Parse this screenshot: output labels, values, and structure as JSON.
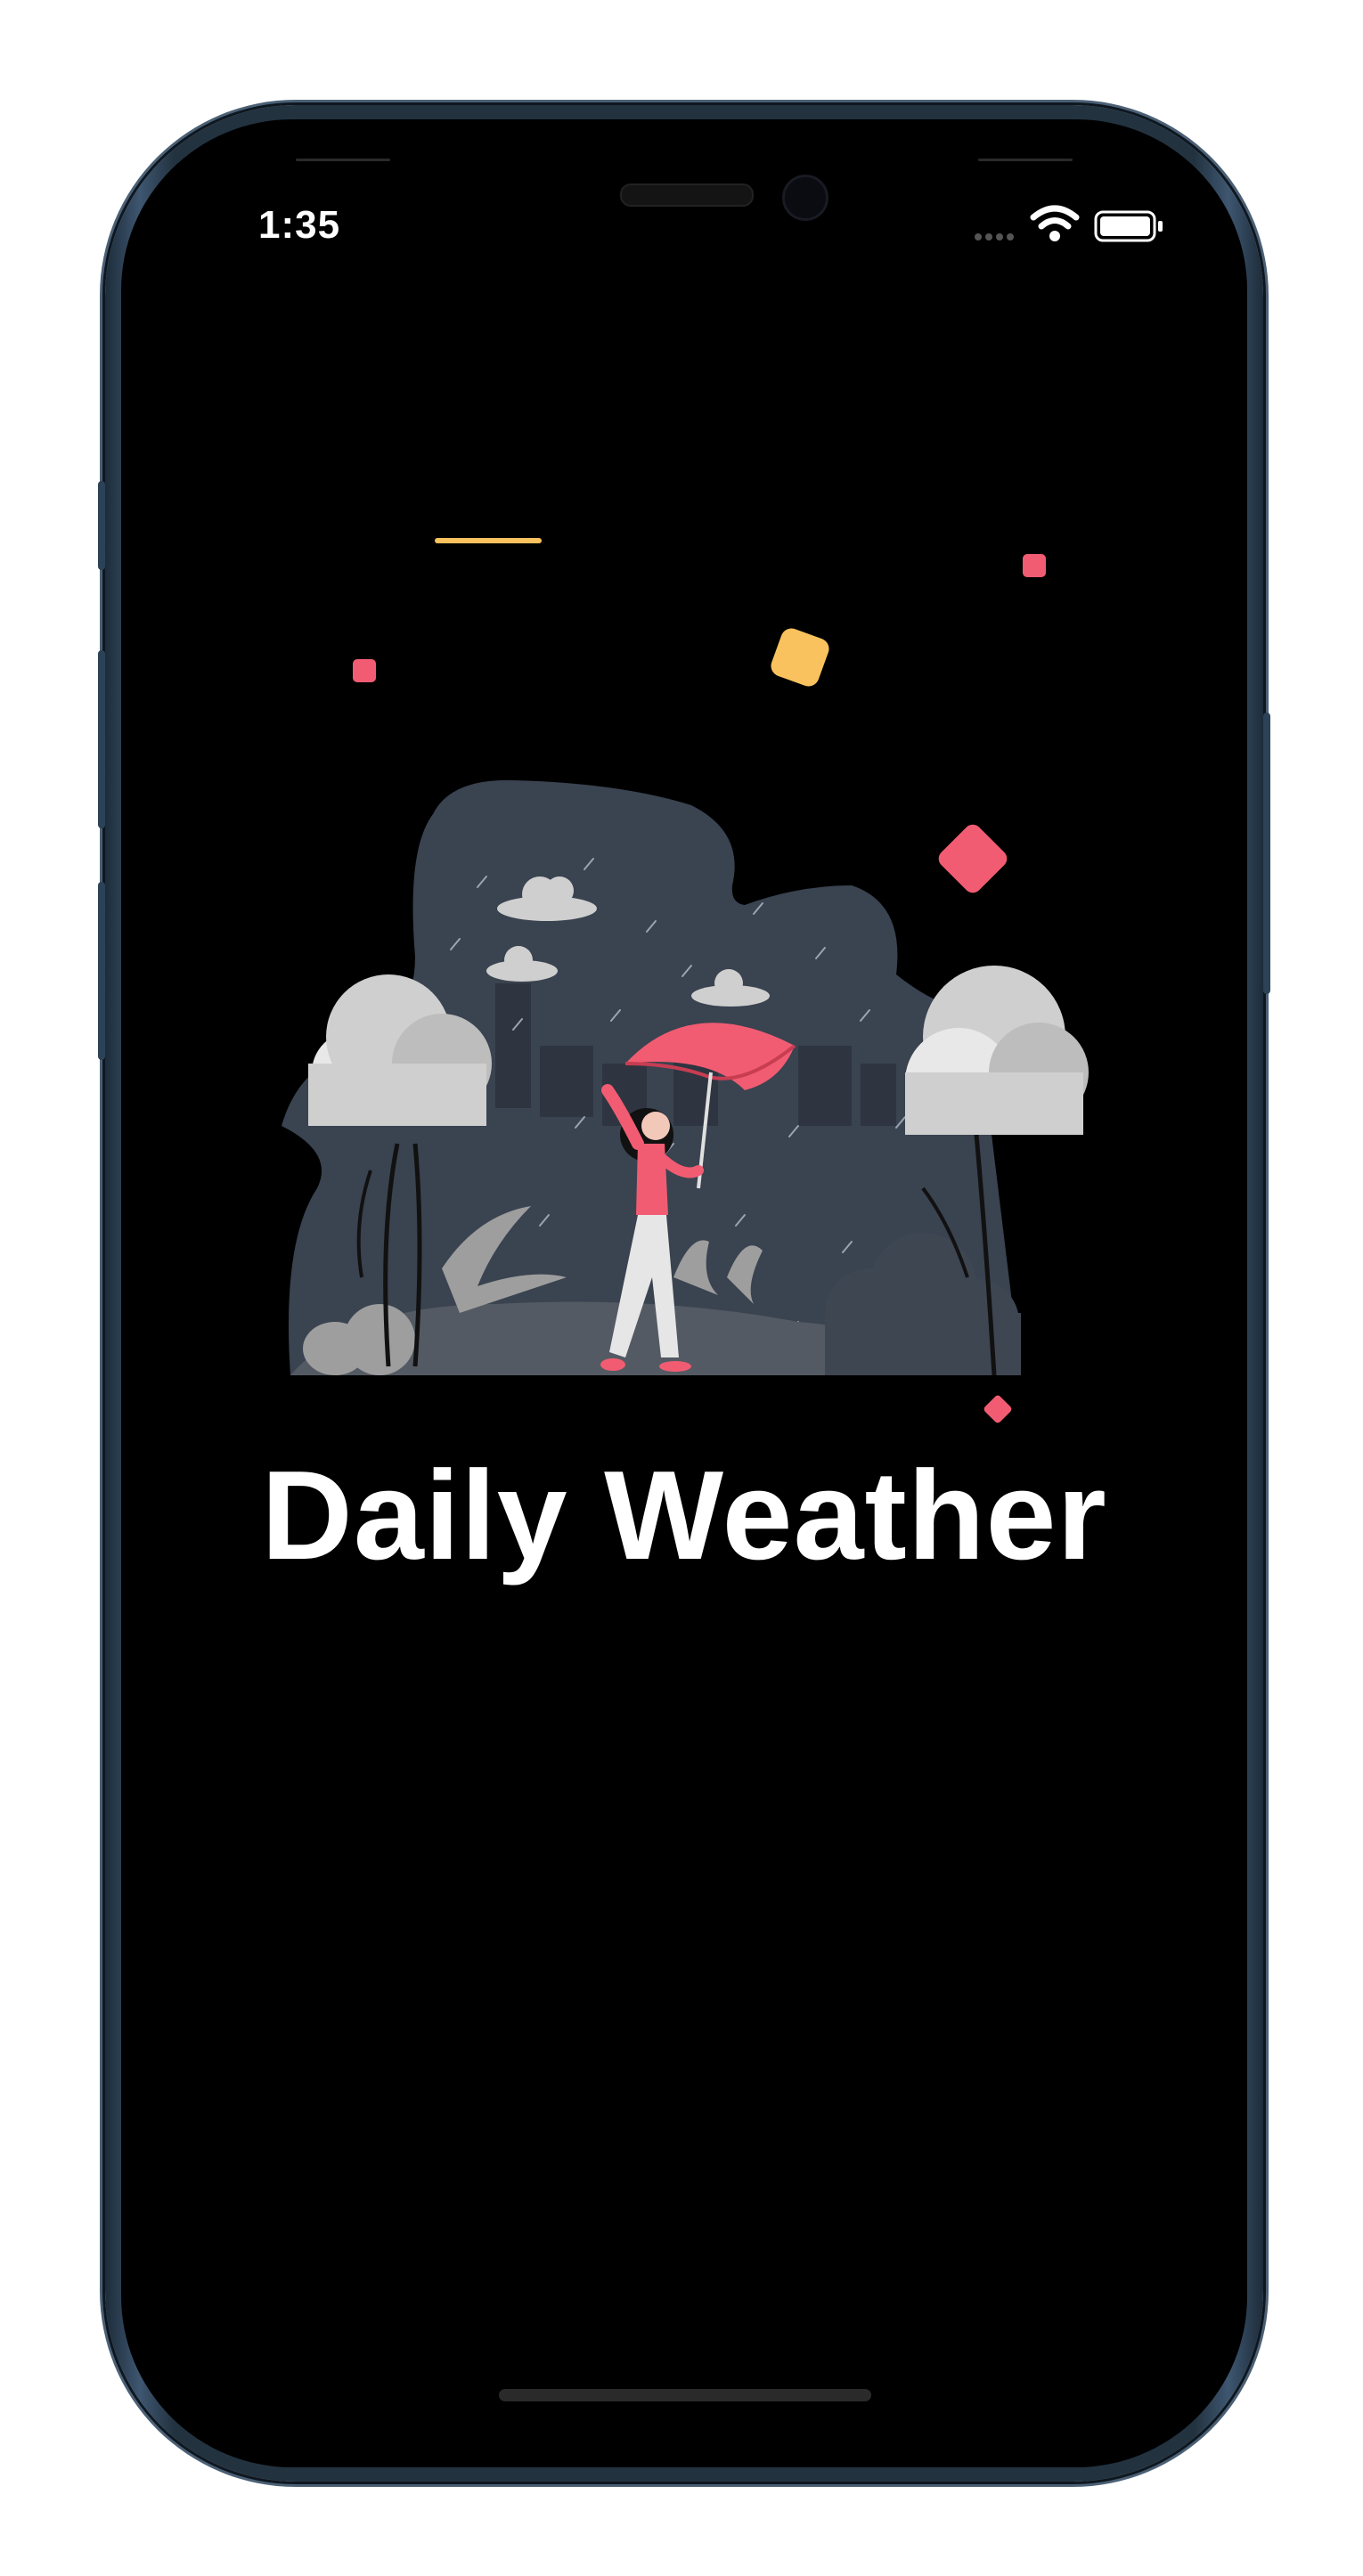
{
  "status_bar": {
    "time": "1:35"
  },
  "app": {
    "title": "Daily Weather"
  },
  "colors": {
    "background": "#000000",
    "accent_pink": "#f25c72",
    "accent_yellow": "#f9c25e",
    "cloud_gray": "#cfcfcf",
    "scene_dark": "#3b4452"
  },
  "icons": {
    "signal": "cellular-signal-icon",
    "wifi": "wifi-icon",
    "battery": "battery-icon"
  }
}
